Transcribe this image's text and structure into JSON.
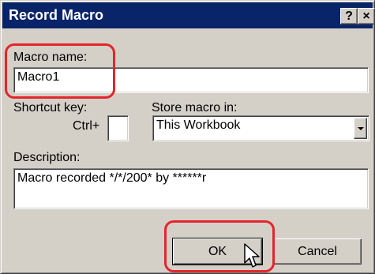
{
  "window": {
    "title": "Record Macro",
    "help_glyph": "?",
    "close_glyph": "×"
  },
  "macro_name": {
    "label": "Macro name:",
    "value": "Macro1"
  },
  "shortcut": {
    "label": "Shortcut key:",
    "prefix": "Ctrl+",
    "value": ""
  },
  "store_in": {
    "label": "Store macro in:",
    "selected": "This Workbook"
  },
  "description": {
    "label": "Description:",
    "value": "Macro recorded */*/200* by ******r"
  },
  "buttons": {
    "ok": "OK",
    "cancel": "Cancel"
  },
  "colors": {
    "titlebar": "#0a246a",
    "dialog_bg": "#d4d0c8",
    "highlight": "#e3262b"
  },
  "icons": [
    "help-icon",
    "close-icon",
    "dropdown-arrow-icon",
    "mouse-pointer-icon"
  ]
}
